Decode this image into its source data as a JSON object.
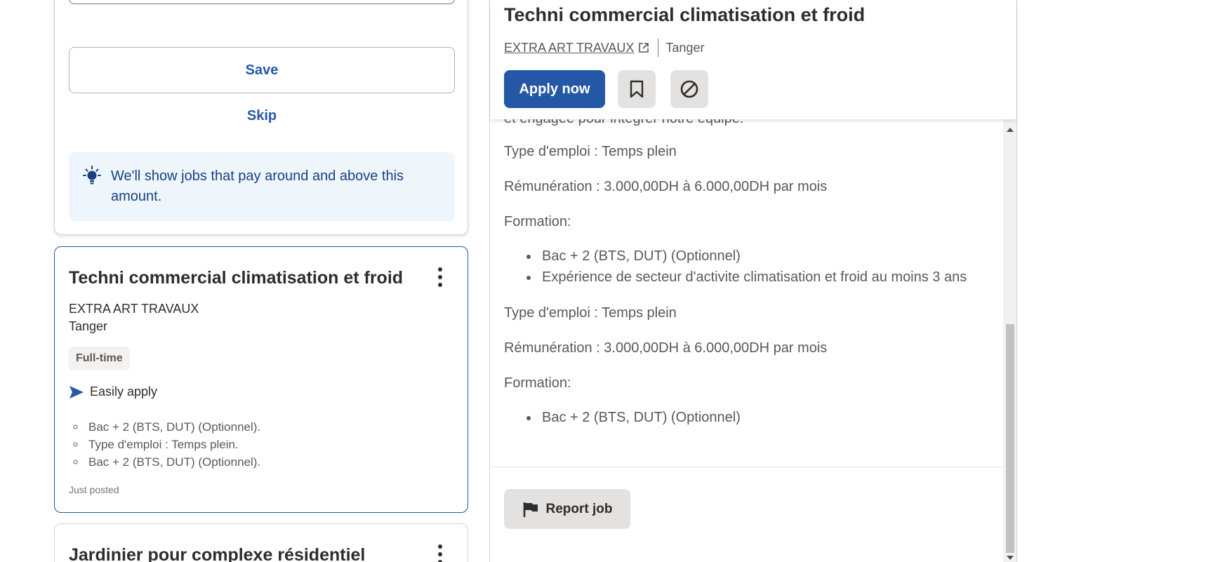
{
  "salary_prompt": {
    "save_label": "Save",
    "skip_label": "Skip",
    "tip_text": "We'll show jobs that pay around and above this amount.",
    "tip_icon": "lightbulb-icon"
  },
  "job_list": [
    {
      "title": "Techni commercial climatisation et froid",
      "company": "EXTRA ART TRAVAUX",
      "location": "Tanger",
      "job_type": "Full-time",
      "easy_apply_label": "Easily apply",
      "snippets": [
        "Bac + 2 (BTS, DUT) (Optionnel).",
        "Type d'emploi : Temps plein.",
        "Bac + 2 (BTS, DUT) (Optionnel)."
      ],
      "posted": "Just posted"
    },
    {
      "title": "Jardinier pour complexe résidentiel"
    }
  ],
  "job_detail": {
    "title": "Techni commercial climatisation et froid",
    "company": "EXTRA ART TRAVAUX",
    "location": "Tanger",
    "apply_label": "Apply now",
    "report_label": "Report job",
    "description": {
      "cut_line": "et engagée pour intégrer notre équipe.",
      "type_1": "Type d'emploi : Temps plein",
      "pay_1": "Rémunération : 3.000,00DH à 6.000,00DH par mois",
      "formation_1": "Formation:",
      "bullets_1": [
        "Bac + 2 (BTS, DUT) (Optionnel)",
        "Expérience de secteur d'activite climatisation et froid au moins 3 ans"
      ],
      "type_2": "Type d'emploi : Temps plein",
      "pay_2": "Rémunération : 3.000,00DH à 6.000,00DH par mois",
      "formation_2": "Formation:",
      "bullets_2": [
        "Bac + 2 (BTS, DUT) (Optionnel)"
      ]
    }
  },
  "colors": {
    "brand_blue": "#2557a7",
    "tip_background": "#eef6fc",
    "button_grey": "#e4e2e0"
  }
}
